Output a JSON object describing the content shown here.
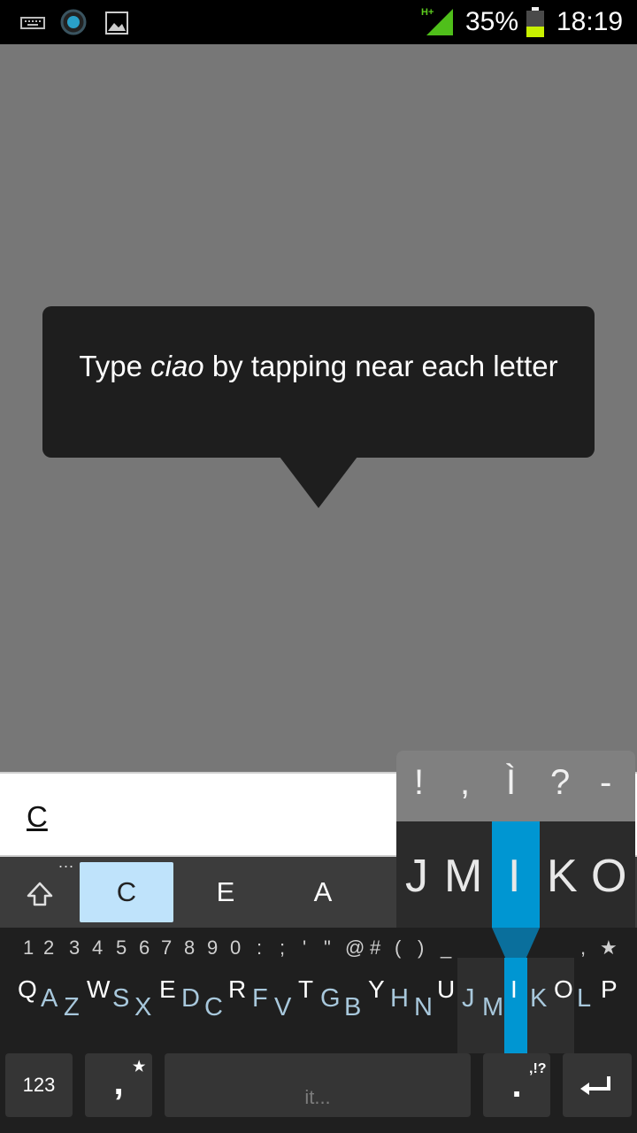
{
  "status_bar": {
    "network": "H+",
    "battery_percent": "35%",
    "time": "18:19",
    "icons": [
      "keyboard-icon",
      "circle-notification-icon",
      "image-icon",
      "signal-icon",
      "battery-icon"
    ]
  },
  "tooltip": {
    "text_before": "Type ",
    "text_emphasis": "ciao",
    "text_after": " by tapping near each letter"
  },
  "input": {
    "value": "C"
  },
  "suggestions": {
    "more_indicator": "...",
    "items": [
      "C",
      "E",
      "A"
    ],
    "selected_index": 0
  },
  "keyboard": {
    "hints": [
      "1",
      "2",
      "3",
      "4",
      "5",
      "6",
      "7",
      "8",
      "9",
      "0",
      ":",
      ";",
      "'",
      "\"",
      "@",
      "#",
      "(",
      ")",
      "_",
      ",",
      "★"
    ],
    "upper": [
      "Q",
      "W",
      "E",
      "R",
      "T",
      "Y",
      "U",
      "I",
      "O",
      "P"
    ],
    "lower": [
      "A",
      "Z",
      "S",
      "X",
      "D",
      "C",
      "F",
      "V",
      "G",
      "B",
      "H",
      "N",
      "J",
      "M",
      "K",
      "L"
    ],
    "bottom": {
      "numbers_label": "123",
      "comma_label": ",",
      "star_label": "★",
      "space_label": "it...",
      "period_label": ".",
      "punct_label": ",!?"
    }
  },
  "popup": {
    "alternates": [
      "!",
      ",",
      "Ì",
      "?",
      "-"
    ],
    "keys": [
      "J",
      "M",
      "I",
      "K",
      "O"
    ]
  },
  "colors": {
    "accent": "#0096d2",
    "selected_suggestion": "#bfe3fb",
    "tooltip_bg": "#1e1e1e"
  }
}
